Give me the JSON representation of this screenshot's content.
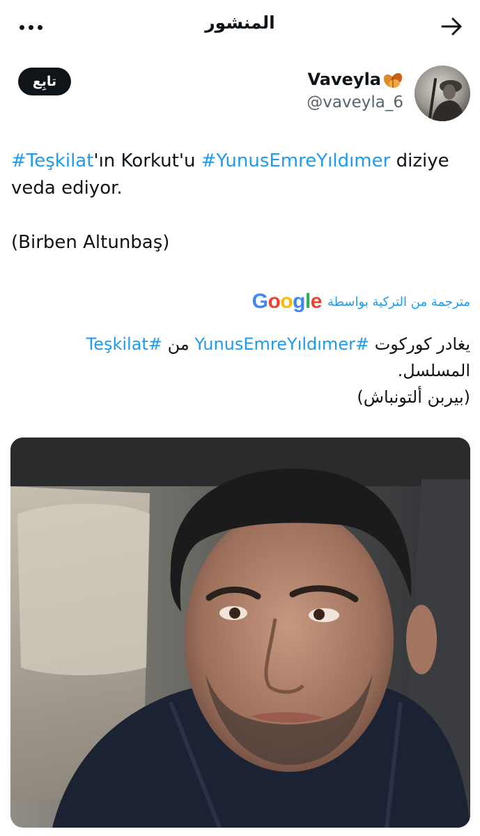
{
  "header": {
    "title": "المنشور",
    "more_icon": "more-dots-icon",
    "back_icon": "arrow-right-icon"
  },
  "author": {
    "display_name": "Vaveyla",
    "emoji": "leaf-emoji",
    "handle": "@vaveyla_6",
    "follow_label": "تابِع"
  },
  "tweet": {
    "line1_tag1": "#Teşkilat",
    "line1_mid": "'ın Korkut'u ",
    "line1_tag2": "#YunusEmreYıldımer",
    "line1_end": " diziye",
    "line2": "veda ediyor.",
    "line3": "(Birben Altunbaş)"
  },
  "translation": {
    "label": "مترجمة من التركية بواسطة",
    "provider": "Google",
    "line1_start": "يغادر كوركوت ",
    "line1_tag1": "#YunusEmreYıldımer",
    "line1_mid": " من ",
    "line1_tag2": "#Teşkilat",
    "line2": "المسلسل.",
    "line3": "(بيربن ألتونباش)"
  },
  "media": {
    "alt": "photo-of-man-in-car"
  },
  "colors": {
    "accent": "#1d9bf0",
    "text": "#0f1419",
    "secondary": "#536471",
    "button": "#0f1419"
  }
}
